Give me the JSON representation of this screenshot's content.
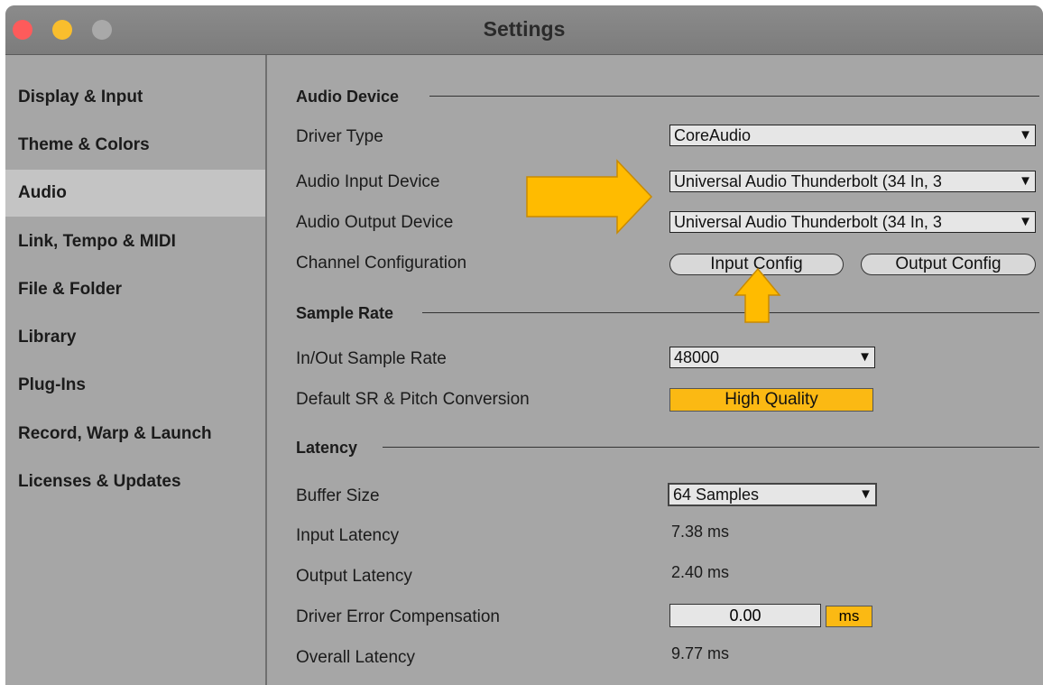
{
  "window": {
    "title": "Settings"
  },
  "sidebar": {
    "items": [
      {
        "label": "Display & Input"
      },
      {
        "label": "Theme & Colors"
      },
      {
        "label": "Audio"
      },
      {
        "label": "Link, Tempo & MIDI"
      },
      {
        "label": "File & Folder"
      },
      {
        "label": "Library"
      },
      {
        "label": "Plug-Ins"
      },
      {
        "label": "Record, Warp & Launch"
      },
      {
        "label": "Licenses & Updates"
      }
    ],
    "active": "Audio"
  },
  "audio_device": {
    "title": "Audio Device",
    "driver_type_label": "Driver Type",
    "driver_type_value": "CoreAudio",
    "input_device_label": "Audio Input Device",
    "input_device_value": "Universal Audio Thunderbolt (34 In, 3",
    "output_device_label": "Audio Output Device",
    "output_device_value": "Universal Audio Thunderbolt (34 In, 3",
    "channel_config_label": "Channel Configuration",
    "input_config_button": "Input Config",
    "output_config_button": "Output Config"
  },
  "sample_rate": {
    "title": "Sample Rate",
    "rate_label": "In/Out Sample Rate",
    "rate_value": "48000",
    "conversion_label": "Default SR & Pitch Conversion",
    "conversion_value": "High Quality"
  },
  "latency": {
    "title": "Latency",
    "buffer_label": "Buffer Size",
    "buffer_value": "64 Samples",
    "input_latency_label": "Input Latency",
    "input_latency_value": "7.38 ms",
    "output_latency_label": "Output Latency",
    "output_latency_value": "2.40 ms",
    "driver_comp_label": "Driver Error Compensation",
    "driver_comp_value": "0.00",
    "driver_comp_unit": "ms",
    "overall_label": "Overall Latency",
    "overall_value": "9.77 ms"
  },
  "dropdown_arrow": "▼",
  "colors": {
    "accent": "#fbb913",
    "background": "#a6a6a6",
    "annotation_arrow": "#ffbb00"
  }
}
